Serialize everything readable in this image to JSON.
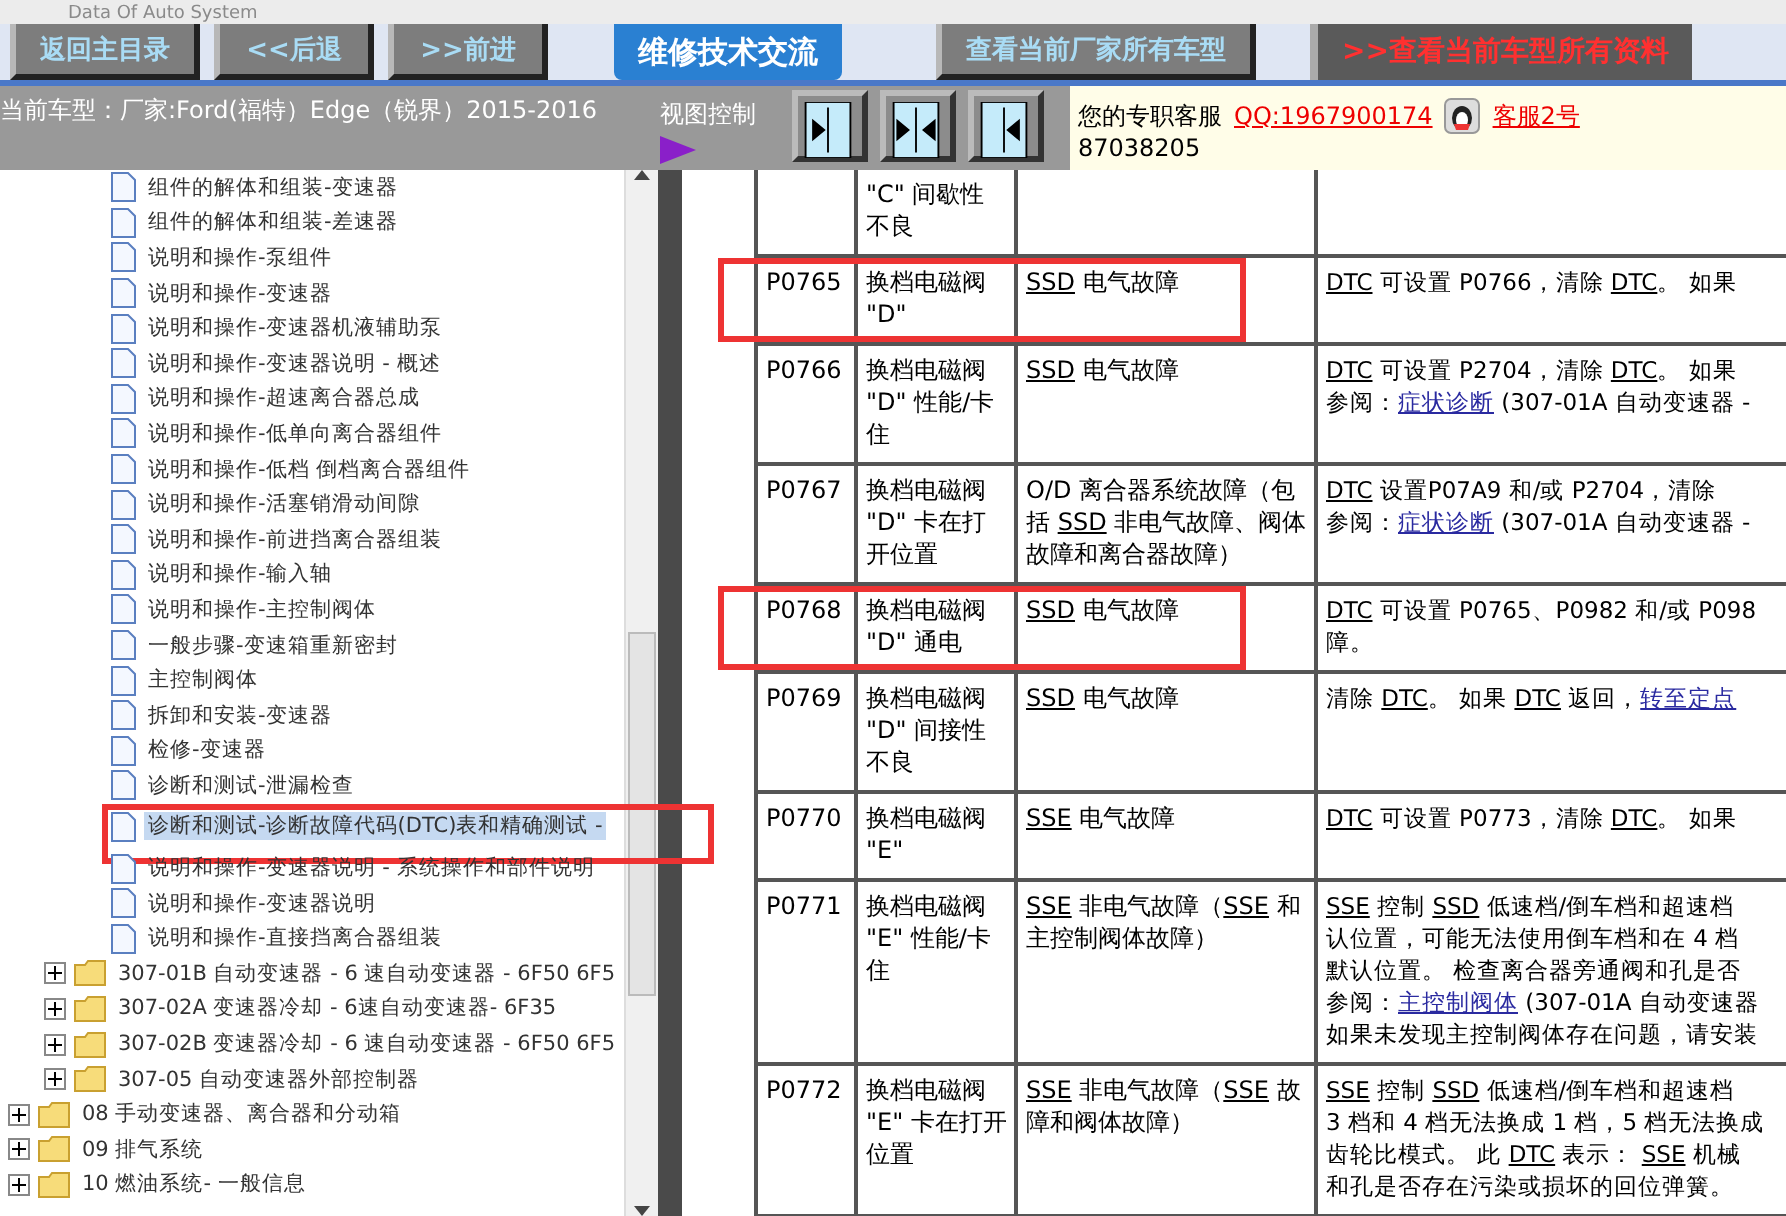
{
  "app": {
    "title": "Data Of Auto System"
  },
  "nav_buttons": [
    {
      "label": "返回主目录",
      "kind": "gray"
    },
    {
      "label": "<<后退",
      "kind": "gray"
    },
    {
      "label": ">>前进",
      "kind": "gray"
    },
    {
      "label": "维修技术交流",
      "kind": "blue"
    },
    {
      "label": "查看当前厂家所有车型",
      "kind": "gray"
    },
    {
      "label": ">>查看当前车型所有资料",
      "kind": "dark"
    }
  ],
  "current_model": "当前车型：厂家:Ford(福特）Edge（锐界）2015-2016",
  "view_control": {
    "label": "视图控制",
    "buttons": [
      {
        "kind": "right"
      },
      {
        "kind": "both"
      },
      {
        "kind": "left"
      }
    ]
  },
  "support": {
    "label": "您的专职客服",
    "qq": "QQ:1967900174",
    "agent": "客服2号",
    "number": "87038205"
  },
  "tree": [
    {
      "children": [
        {
          "children": [
            {
              "label": "组件的解体和组装-变速器",
              "kind": "page",
              "selected": false
            },
            {
              "label": "组件的解体和组装-差速器",
              "kind": "page",
              "selected": false
            },
            {
              "label": "说明和操作-泵组件",
              "kind": "page",
              "selected": false
            },
            {
              "label": "说明和操作-变速器",
              "kind": "page",
              "selected": false
            },
            {
              "label": "说明和操作-变速器机液辅助泵",
              "kind": "page",
              "selected": false
            },
            {
              "label": "说明和操作-变速器说明 - 概述",
              "kind": "page",
              "selected": false
            },
            {
              "label": "说明和操作-超速离合器总成",
              "kind": "page",
              "selected": false
            },
            {
              "label": "说明和操作-低单向离合器组件",
              "kind": "page",
              "selected": false
            },
            {
              "label": "说明和操作-低档 倒档离合器组件",
              "kind": "page",
              "selected": false
            },
            {
              "label": "说明和操作-活塞销滑动间隙",
              "kind": "page",
              "selected": false
            },
            {
              "label": "说明和操作-前进挡离合器组装",
              "kind": "page",
              "selected": false
            },
            {
              "label": "说明和操作-输入轴",
              "kind": "page",
              "selected": false
            },
            {
              "label": "说明和操作-主控制阀体",
              "kind": "page",
              "selected": false
            },
            {
              "label": "一般步骤-变速箱重新密封",
              "kind": "page",
              "selected": false
            },
            {
              "label": "主控制阀体",
              "kind": "page",
              "selected": false
            },
            {
              "label": "拆卸和安装-变速器",
              "kind": "page",
              "selected": false
            },
            {
              "label": "检修-变速器",
              "kind": "page",
              "selected": false
            },
            {
              "label": "诊断和测试-泄漏检查",
              "kind": "page",
              "selected": false
            },
            {
              "label": "诊断和测试-诊断故障代码(DTC)表和精确测试 -",
              "kind": "page",
              "selected": true,
              "highlighted": true
            },
            {
              "label": "说明和操作-变速器说明 - 系统操作和部件说明",
              "kind": "page",
              "selected": false
            },
            {
              "label": "说明和操作-变速器说明",
              "kind": "page",
              "selected": false
            },
            {
              "label": "说明和操作-直接挡离合器组装",
              "kind": "page",
              "selected": false
            }
          ]
        },
        {
          "label": "307-01B 自动变速器 - 6 速自动变速器 - 6F50 6F5",
          "kind": "folder",
          "expanded": false
        },
        {
          "label": "307-02A 变速器冷却 - 6速自动变速器- 6F35",
          "kind": "folder",
          "expanded": false
        },
        {
          "label": "307-02B 变速器冷却 - 6 速自动变速器 - 6F50 6F5",
          "kind": "folder",
          "expanded": false
        },
        {
          "label": "307-05 自动变速器外部控制器",
          "kind": "folder",
          "expanded": false
        }
      ]
    },
    {
      "label": "08 手动变速器、离合器和分动箱",
      "kind": "folder",
      "expanded": false
    },
    {
      "label": "09 排气系统",
      "kind": "folder",
      "expanded": false
    },
    {
      "label": "10 燃油系统- 一般信息",
      "kind": "folder",
      "expanded": false
    }
  ],
  "table": {
    "rows": [
      {
        "name": "\"C\" 间歇性不良",
        "highlighted": false
      },
      {
        "code": "P0765",
        "name": "换档电磁阀 \"D\"",
        "fault": [
          {
            "kind": "abbr",
            "text": "SSD"
          },
          " 电气故障"
        ],
        "detail": [
          [
            {
              "kind": "abbr",
              "text": "DTC"
            },
            " 可设置 P0766，清除 ",
            {
              "kind": "abbr",
              "text": "DTC"
            },
            "。 如果"
          ]
        ],
        "highlighted": true
      },
      {
        "code": "P0766",
        "name": "换档电磁阀 \"D\" 性能/卡住",
        "fault": [
          {
            "kind": "abbr",
            "text": "SSD"
          },
          " 电气故障"
        ],
        "detail": [
          [
            {
              "kind": "abbr",
              "text": "DTC"
            },
            " 可设置 P2704，清除 ",
            {
              "kind": "abbr",
              "text": "DTC"
            },
            "。 如果"
          ],
          [
            "参阅：",
            {
              "kind": "link",
              "text": "症状诊断"
            },
            " (307-01A 自动变速器 -"
          ]
        ],
        "highlighted": false
      },
      {
        "code": "P0767",
        "name": "换档电磁阀 \"D\" 卡在打开位置",
        "fault": [
          "O/D 离合器系统故障（包括 ",
          {
            "kind": "abbr",
            "text": "SSD"
          },
          " 非电气故障、阀体故障和离合器故障）"
        ],
        "detail": [
          [
            {
              "kind": "abbr",
              "text": "DTC"
            },
            " 设置P07A9 和/或 P2704，清除"
          ],
          [
            "参阅：",
            {
              "kind": "link",
              "text": "症状诊断"
            },
            " (307-01A 自动变速器 -"
          ]
        ],
        "highlighted": false
      },
      {
        "code": "P0768",
        "name": "换档电磁阀 \"D\" 通电",
        "fault": [
          {
            "kind": "abbr",
            "text": "SSD"
          },
          " 电气故障"
        ],
        "detail": [
          [
            {
              "kind": "abbr",
              "text": "DTC"
            },
            " 可设置 P0765、P0982 和/或 P098"
          ],
          [
            "障。"
          ]
        ],
        "highlighted": true
      },
      {
        "code": "P0769",
        "name": "换档电磁阀 \"D\" 间接性不良",
        "fault": [
          {
            "kind": "abbr",
            "text": "SSD"
          },
          " 电气故障"
        ],
        "detail": [
          [
            "清除 ",
            {
              "kind": "abbr",
              "text": "DTC"
            },
            "。 如果 ",
            {
              "kind": "abbr",
              "text": "DTC"
            },
            " 返回，",
            {
              "kind": "link",
              "text": "转至定点"
            }
          ]
        ],
        "highlighted": false
      },
      {
        "code": "P0770",
        "name": "换档电磁阀 \"E\"",
        "fault": [
          {
            "kind": "abbr",
            "text": "SSE"
          },
          " 电气故障"
        ],
        "detail": [
          [
            {
              "kind": "abbr",
              "text": "DTC"
            },
            " 可设置 P0773，清除 ",
            {
              "kind": "abbr",
              "text": "DTC"
            },
            "。 如果"
          ]
        ],
        "highlighted": false
      },
      {
        "code": "P0771",
        "name": "换档电磁阀 \"E\" 性能/卡住",
        "fault": [
          {
            "kind": "abbr",
            "text": "SSE"
          },
          " 非电气故障（",
          {
            "kind": "abbr",
            "text": "SSE"
          },
          " 和主控制阀体故障）"
        ],
        "detail": [
          [
            {
              "kind": "abbr",
              "text": "SSE"
            },
            " 控制 ",
            {
              "kind": "abbr",
              "text": "SSD"
            },
            " 低速档/倒车档和超速档"
          ],
          [
            "认位置，可能无法使用倒车档和在 4 档"
          ],
          [
            "默认位置。 检查离合器旁通阀和孔是否"
          ],
          [
            "参阅：",
            {
              "kind": "link",
              "text": "主控制阀体"
            },
            " (307-01A 自动变速器"
          ],
          [
            "如果未发现主控制阀体存在问题，请安装"
          ]
        ],
        "highlighted": false
      },
      {
        "code": "P0772",
        "name": "换档电磁阀 \"E\" 卡在打开位置",
        "fault": [
          {
            "kind": "abbr",
            "text": "SSE"
          },
          " 非电气故障（",
          {
            "kind": "abbr",
            "text": "SSE"
          },
          " 故障和阀体故障）"
        ],
        "detail": [
          [
            {
              "kind": "abbr",
              "text": "SSE"
            },
            " 控制 ",
            {
              "kind": "abbr",
              "text": "SSD"
            },
            " 低速档/倒车档和超速档"
          ],
          [
            "3 档和 4 档无法换成 1 档，5 档无法换成"
          ],
          [
            "齿轮比模式。 此 ",
            {
              "kind": "abbr",
              "text": "DTC"
            },
            " 表示： ",
            {
              "kind": "abbr",
              "text": "SSE"
            },
            " 机械"
          ],
          [
            "和孔是否存在污染或损坏的回位弹簧。"
          ]
        ],
        "highlighted": false
      }
    ]
  }
}
